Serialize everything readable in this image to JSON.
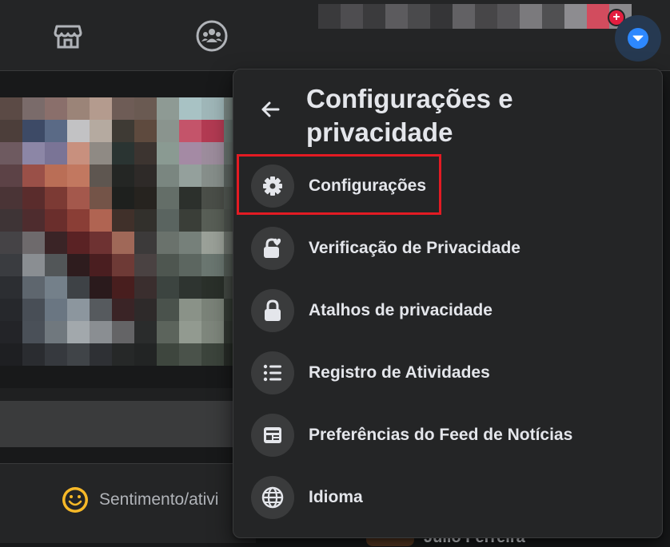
{
  "topbar": {
    "marketplace_icon": "storefront-icon",
    "groups_icon": "groups-icon",
    "notification_badge": "+",
    "account_icon": "caret-down-icon"
  },
  "menu": {
    "back_icon": "arrow-left-icon",
    "title": "Configurações e privacidade",
    "items": [
      {
        "label": "Configurações",
        "icon": "gear-icon"
      },
      {
        "label": "Verificação de Privacidade",
        "icon": "lock-heart-icon"
      },
      {
        "label": "Atalhos de privacidade",
        "icon": "lock-icon"
      },
      {
        "label": "Registro de Atividades",
        "icon": "list-icon"
      },
      {
        "label": "Preferências do Feed de Notícias",
        "icon": "feed-icon"
      },
      {
        "label": "Idioma",
        "icon": "globe-icon"
      }
    ]
  },
  "feed": {
    "feeling_label": "Sentimento/ativi",
    "behind_name": "Júlio Ferreira"
  },
  "colors": {
    "highlight": "#e31b23",
    "accent": "#2d88ff",
    "background": "#18191a",
    "surface": "#242526"
  }
}
